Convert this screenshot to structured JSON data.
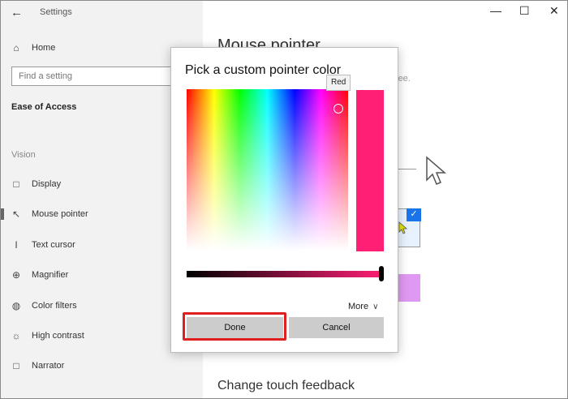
{
  "window": {
    "app_title": "Settings",
    "minimize": "—",
    "maximize": "☐",
    "close": "✕"
  },
  "sidebar": {
    "home_label": "Home",
    "search_placeholder": "Find a setting",
    "category": "Ease of Access",
    "section_vision": "Vision",
    "items": [
      {
        "label": "Display",
        "icon": "monitor-icon"
      },
      {
        "label": "Mouse pointer",
        "icon": "mouse-pointer-icon"
      },
      {
        "label": "Text cursor",
        "icon": "text-cursor-icon"
      },
      {
        "label": "Magnifier",
        "icon": "magnifier-icon"
      },
      {
        "label": "Color filters",
        "icon": "color-filters-icon"
      },
      {
        "label": "High contrast",
        "icon": "high-contrast-icon"
      },
      {
        "label": "Narrator",
        "icon": "narrator-icon"
      }
    ]
  },
  "main": {
    "heading": "Mouse pointer",
    "hint_fragment": "er to see.",
    "bottom_heading": "Change touch feedback",
    "custom_swatch_color": "#e099f2"
  },
  "dialog": {
    "title": "Pick a custom pointer color",
    "tooltip": "Red",
    "selected_color": "#ff1f75",
    "more_label": "More",
    "done_label": "Done",
    "cancel_label": "Cancel"
  }
}
